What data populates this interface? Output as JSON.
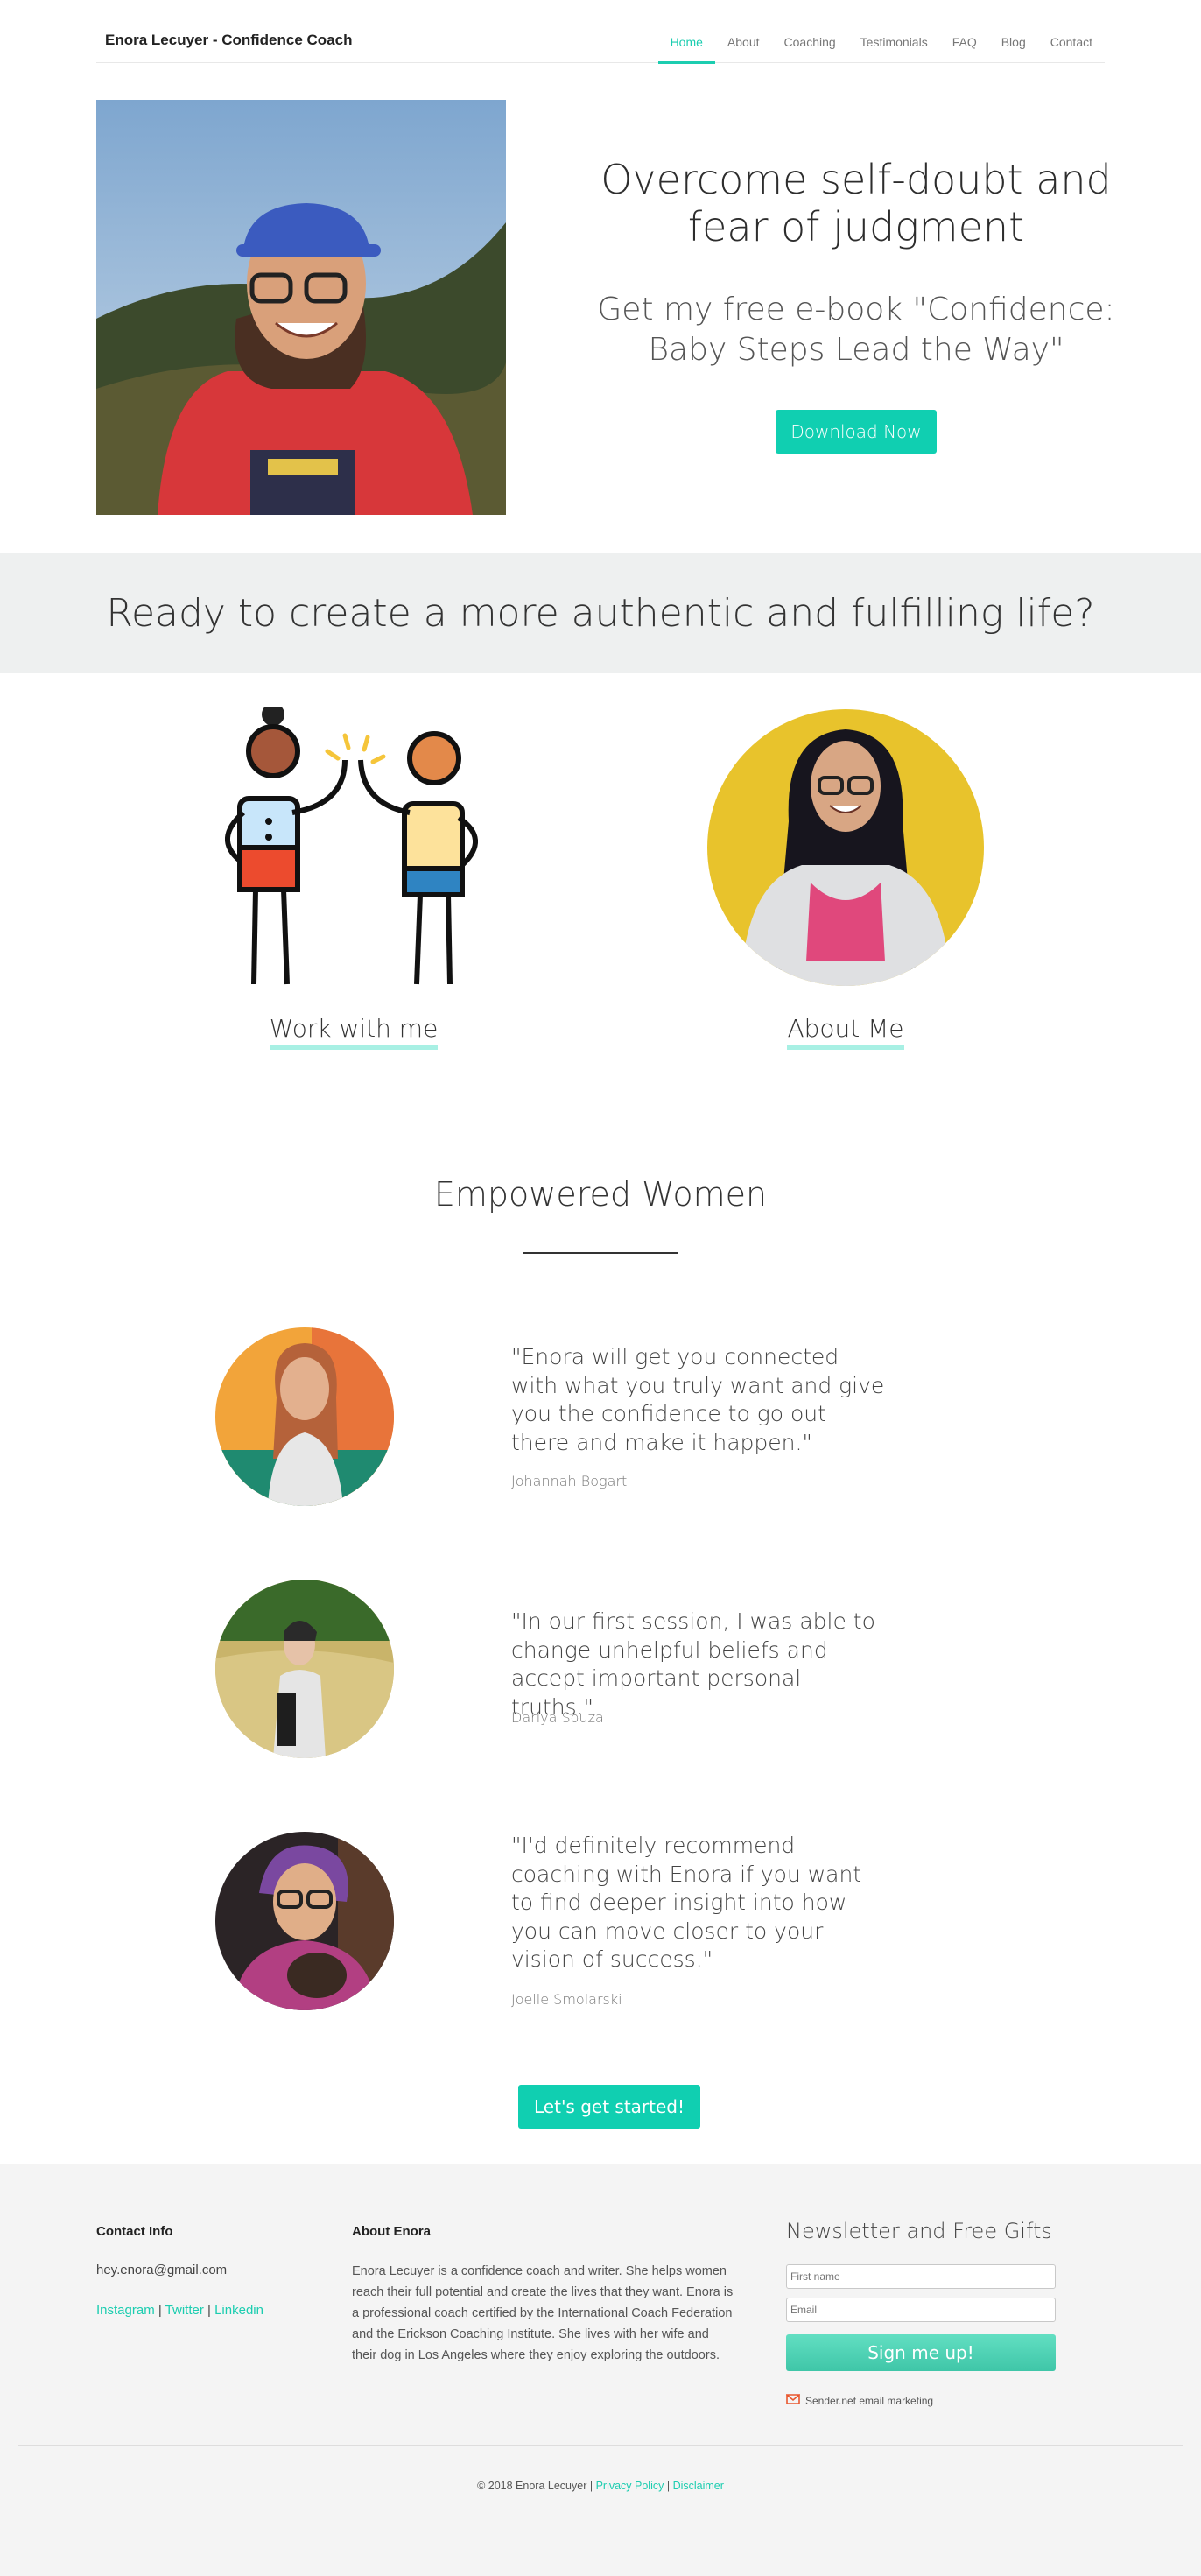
{
  "brand": "Enora Lecuyer - Confidence Coach",
  "nav": {
    "items": [
      {
        "label": "Home",
        "active": true
      },
      {
        "label": "About"
      },
      {
        "label": "Coaching"
      },
      {
        "label": "Testimonials"
      },
      {
        "label": "FAQ"
      },
      {
        "label": "Blog"
      },
      {
        "label": "Contact"
      }
    ]
  },
  "hero": {
    "title": "Overcome self-doubt and fear of judgment",
    "subtitle": "Get my free e-book \"Confidence: Baby Steps Lead the Way\"",
    "button": "Download Now"
  },
  "band": {
    "text": "Ready to create a more authentic and fulfilling life?"
  },
  "cards": {
    "work": "Work with me",
    "about": "About Me"
  },
  "testimonials": {
    "title": "Empowered Women",
    "items": [
      {
        "quote": "\"Enora will get you connected with what you truly want and give you the confidence to go out there and make it happen.\"",
        "author": "Johannah Bogart"
      },
      {
        "quote": "\"In our first session, I was able to change unhelpful beliefs and accept important personal truths.\"",
        "author": "Dariya Souza"
      },
      {
        "quote": "\"I'd definitely recommend coaching with Enora if you want to find deeper insight into how you can move closer to your vision of success.\"",
        "author": "Joelle Smolarski"
      }
    ]
  },
  "cta": "Let's get started!",
  "footer": {
    "contact_title": "Contact Info",
    "email": "hey.enora@gmail.com",
    "social": {
      "instagram": "Instagram",
      "twitter": "Twitter",
      "linkedin": "Linkedin",
      "sep": " | "
    },
    "about_title": "About Enora",
    "about_text": "Enora Lecuyer is a confidence coach and writer. She helps women reach their full potential and create the lives that they want. Enora is a professional coach certified by the International Coach Federation and the Erickson Coaching Institute. She lives with her wife and their dog in Los Angeles where they enjoy exploring the outdoors.",
    "newsletter_title": "Newsletter and Free Gifts",
    "first_name_placeholder": "First name",
    "email_placeholder": "Email",
    "signup": "Sign me up!",
    "sender": "Sender.net email marketing",
    "copyright": "© 2018 Enora Lecuyer | ",
    "privacy": "Privacy Policy",
    "disclaimer": "Disclaimer"
  },
  "colors": {
    "accent": "#10cfb1",
    "band": "#eef0f0",
    "footer": "#f4f4f4"
  }
}
